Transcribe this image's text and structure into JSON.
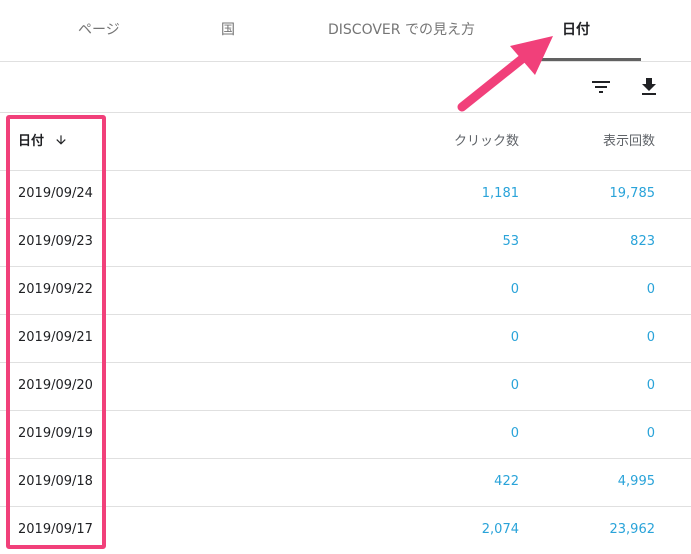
{
  "tabs": [
    {
      "label": "ページ",
      "active": false
    },
    {
      "label": "国",
      "active": false
    },
    {
      "label": "DISCOVER での見え方",
      "active": false
    },
    {
      "label": "日付",
      "active": true
    }
  ],
  "toolbar": {
    "filter_icon": "filter-icon",
    "download_icon": "download-icon"
  },
  "table": {
    "headers": {
      "date": "日付",
      "clicks": "クリック数",
      "impressions": "表示回数"
    },
    "sort": {
      "column": "date",
      "direction": "descending",
      "icon": "arrow-down-icon"
    },
    "rows": [
      {
        "date": "2019/09/24",
        "clicks": "1,181",
        "impressions": "19,785"
      },
      {
        "date": "2019/09/23",
        "clicks": "53",
        "impressions": "823"
      },
      {
        "date": "2019/09/22",
        "clicks": "0",
        "impressions": "0"
      },
      {
        "date": "2019/09/21",
        "clicks": "0",
        "impressions": "0"
      },
      {
        "date": "2019/09/20",
        "clicks": "0",
        "impressions": "0"
      },
      {
        "date": "2019/09/19",
        "clicks": "0",
        "impressions": "0"
      },
      {
        "date": "2019/09/18",
        "clicks": "422",
        "impressions": "4,995"
      },
      {
        "date": "2019/09/17",
        "clicks": "2,074",
        "impressions": "23,962"
      }
    ]
  },
  "colors": {
    "accent": "#29a3d9",
    "annotation": "#f1407a",
    "text": "#202124",
    "muted": "#757575",
    "divider": "#e0e0e0"
  }
}
